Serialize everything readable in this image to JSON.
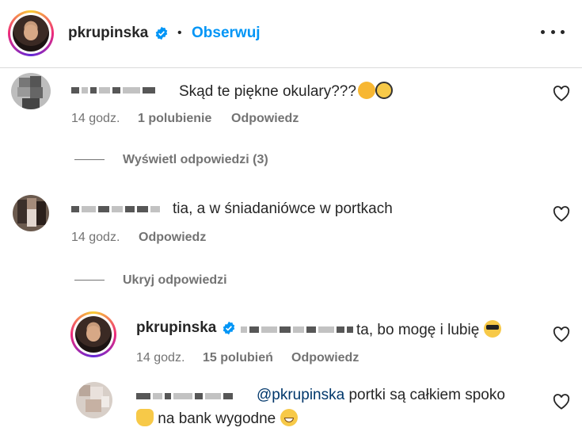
{
  "post_header": {
    "username": "pkrupinska",
    "separator": "•",
    "follow_label": "Obserwuj"
  },
  "comments": [
    {
      "text": "Skąd te piękne okulary???",
      "time": "14 godz.",
      "likes": "1 polubienie",
      "reply_label": "Odpowiedz",
      "thread_toggle": "Wyświetl odpowiedzi (3)"
    },
    {
      "text": "tia, a w śniadaniówce w portkach",
      "time": "14 godz.",
      "reply_label": "Odpowiedz",
      "thread_toggle": "Ukryj odpowiedzi"
    }
  ],
  "replies": [
    {
      "username": "pkrupinska",
      "text": "ta, bo mogę i lubię",
      "time": "14 godz.",
      "likes": "15 polubień",
      "reply_label": "Odpowiedz"
    },
    {
      "mention": "@pkrupinska",
      "text_line1": "portki są całkiem spoko",
      "text_line2": "na bank wygodne"
    }
  ],
  "icons": {
    "heart": "heart-outline-icon",
    "verified": "verified-badge-icon",
    "more": "more-horizontal-icon"
  },
  "colors": {
    "link": "#0095f6",
    "muted": "#737373",
    "verified": "#0095f6"
  }
}
